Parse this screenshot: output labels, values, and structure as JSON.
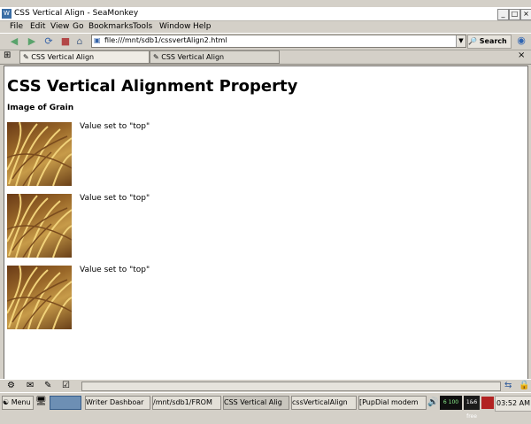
{
  "window": {
    "title": "CSS Vertical Align - SeaMonkey",
    "app_icon_glyph": "W",
    "minimize_glyph": "_",
    "maximize_glyph": "□",
    "close_glyph": "×"
  },
  "menu": [
    "File",
    "Edit",
    "View",
    "Go",
    "Bookmarks",
    "Tools",
    "Window",
    "Help"
  ],
  "nav": {
    "url": "file:///mnt/sdb1/cssvertAlign2.html",
    "search_label": "Search"
  },
  "tabs": [
    "CSS Vertical Align",
    "CSS Vertical Align"
  ],
  "page": {
    "title": "CSS Vertical Alignment Property",
    "subheading": "Image of Grain",
    "rows": [
      {
        "caption": "Value set to \"top\""
      },
      {
        "caption": "Value set to \"top\""
      },
      {
        "caption": "Value set to \"top\""
      }
    ]
  },
  "taskbar": {
    "menu_label": "Menu",
    "items": [
      "Writer Dashboar",
      "/mnt/sdb1/FROM",
      "CSS Vertical Alig",
      "cssVerticalAlign",
      "[PupDial modem"
    ],
    "tray_text": "6 100",
    "free_label": "1&6 free",
    "clock": "03:52 AM"
  },
  "colors": {
    "chrome": "#d4d0c8",
    "page_background": "#ffffff",
    "link_blue": "#3a6ea5"
  }
}
